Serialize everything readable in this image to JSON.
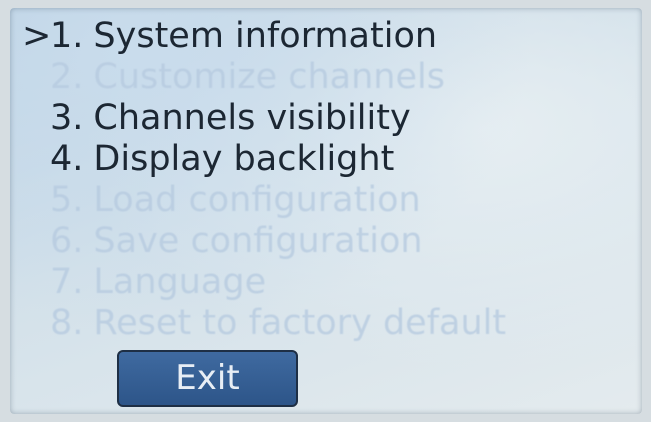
{
  "menu": {
    "cursor": ">",
    "items": [
      {
        "number": "1.",
        "label": "System information",
        "enabled": true,
        "selected": true
      },
      {
        "number": "2.",
        "label": "Customize channels",
        "enabled": false,
        "selected": false
      },
      {
        "number": "3.",
        "label": "Channels visibility",
        "enabled": true,
        "selected": false
      },
      {
        "number": "4.",
        "label": "Display backlight",
        "enabled": true,
        "selected": false
      },
      {
        "number": "5.",
        "label": "Load configuration",
        "enabled": false,
        "selected": false
      },
      {
        "number": "6.",
        "label": "Save configuration",
        "enabled": false,
        "selected": false
      },
      {
        "number": "7.",
        "label": "Language",
        "enabled": false,
        "selected": false
      },
      {
        "number": "8.",
        "label": "Reset to factory default",
        "enabled": false,
        "selected": false
      }
    ]
  },
  "exit_button": {
    "label": "Exit"
  },
  "colors": {
    "text_enabled": "#1c2733",
    "text_disabled": "#b7cbe0",
    "button_fill": "#2d5589",
    "screen_tint": "#d3e1ea"
  }
}
